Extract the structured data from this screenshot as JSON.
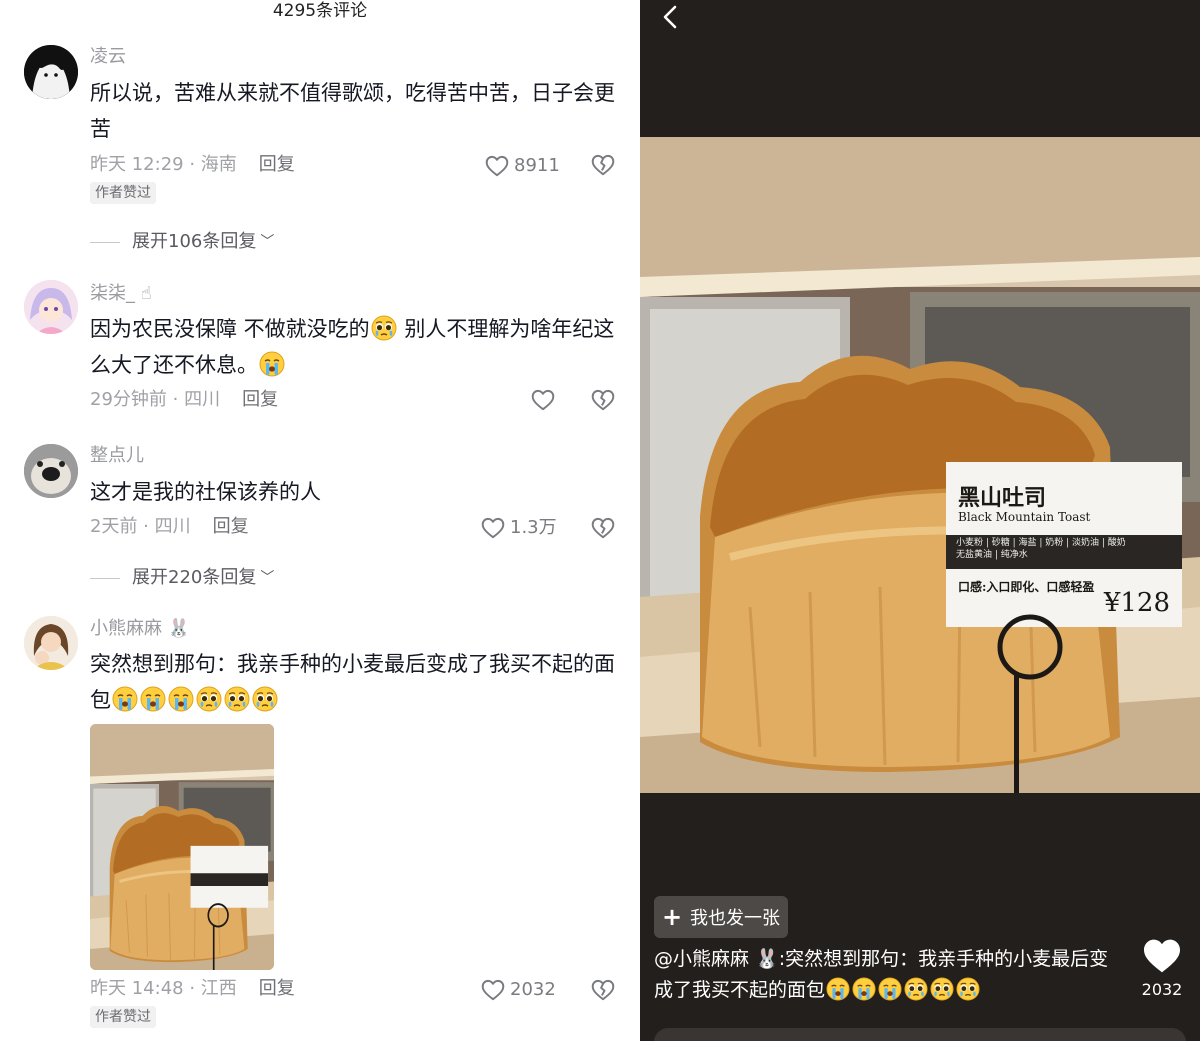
{
  "comments_header": {
    "count_label": "4295条评论"
  },
  "comments": [
    {
      "username": "凌云",
      "text": "所以说，苦难从来就不值得歌颂，吃得苦中苦，日子会更苦",
      "time_location": "昨天 12:29 · 海南",
      "reply_label": "回复",
      "likes": "8911",
      "author_liked": "作者赞过",
      "expand_label": "展开106条回复"
    },
    {
      "username": "柒柒_",
      "text_part1": "因为农民没保障 不做就没吃的",
      "text_part2": " 别人不理解为啥年纪这么大了还不休息。",
      "time_location": "29分钟前 · 四川",
      "reply_label": "回复"
    },
    {
      "username": "整点儿",
      "text": "这才是我的社保该养的人",
      "time_location": "2天前 · 四川",
      "reply_label": "回复",
      "likes": "1.3万",
      "expand_label": "展开220条回复"
    },
    {
      "username": "小熊麻麻",
      "text_part1": "突然想到那句：我亲手种的小麦最后变成了我买不起的",
      "text_part2": "面包",
      "time_location": "昨天 14:48 · 江西",
      "reply_label": "回复",
      "likes": "2032",
      "author_liked": "作者赞过"
    }
  ],
  "viewer": {
    "sign_title": "黑山吐司",
    "sign_subtitle": "Black Mountain Toast",
    "sign_ingredients_1": "小麦粉 | 砂糖 | 海盐 | 奶粉 | 淡奶油 | 酸奶",
    "sign_ingredients_2": "无盐黄油 | 纯净水",
    "sign_taste": "口感:入口即化、口感轻盈",
    "sign_price": "¥128",
    "post_button_label": "我也发一张",
    "caption_user": "@小熊麻麻",
    "caption_text": ":突然想到那句：我亲手种的小麦最后变成了我买不起的面包",
    "like_count": "2032"
  },
  "colors": {
    "viewer_bg": "#231f1c",
    "text_primary": "#161823",
    "text_secondary": "#a0a1a6"
  }
}
